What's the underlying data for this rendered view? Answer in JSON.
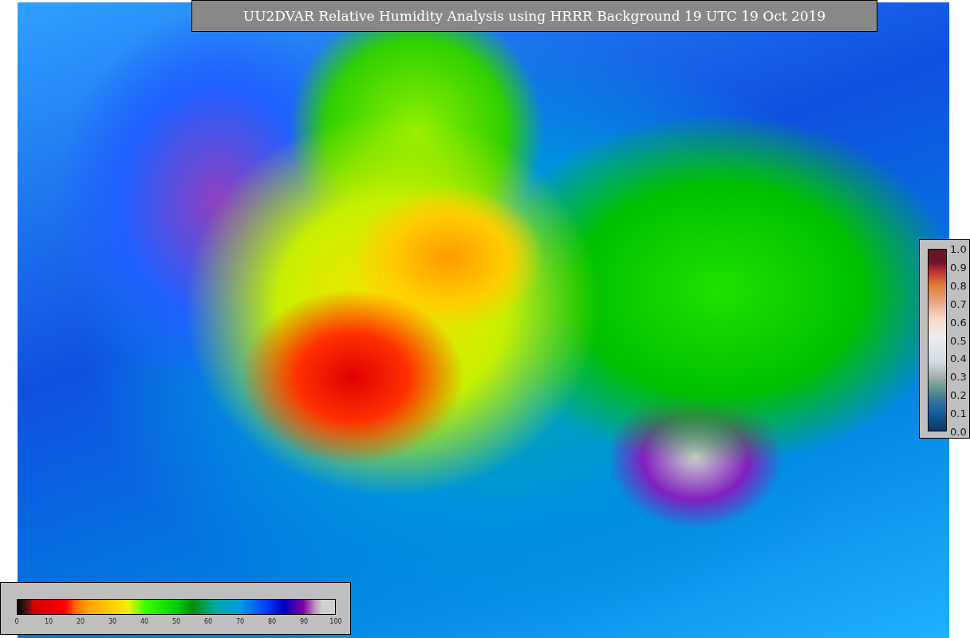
{
  "title": "UU2DVAR Relative Humidity Analysis using HRRR Background 19 UTC 19 Oct 2019",
  "humidity_colorbar": {
    "ticks": [
      "0",
      "10",
      "20",
      "30",
      "40",
      "50",
      "60",
      "70",
      "80",
      "90",
      "100"
    ]
  },
  "station_colorbar": {
    "ticks": [
      "1.0",
      "0.9",
      "0.8",
      "0.7",
      "0.6",
      "0.5",
      "0.4",
      "0.3",
      "0.2",
      "0.1",
      "0.0"
    ]
  }
}
